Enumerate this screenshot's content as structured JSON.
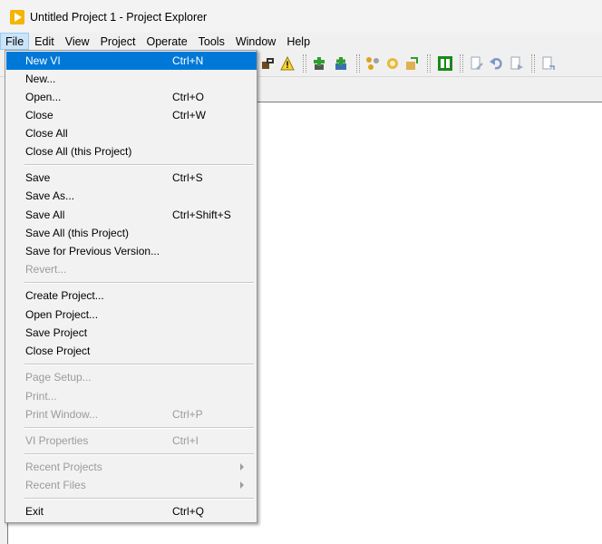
{
  "window": {
    "title": "Untitled Project 1 - Project Explorer"
  },
  "menubar": [
    "File",
    "Edit",
    "View",
    "Project",
    "Operate",
    "Tools",
    "Window",
    "Help"
  ],
  "file_menu": {
    "items": [
      {
        "label": "New VI",
        "shortcut": "Ctrl+N"
      },
      {
        "label": "New...",
        "shortcut": ""
      },
      {
        "label": "Open...",
        "shortcut": "Ctrl+O"
      },
      {
        "label": "Close",
        "shortcut": "Ctrl+W"
      },
      {
        "label": "Close All",
        "shortcut": ""
      },
      {
        "label": "Close All (this Project)",
        "shortcut": ""
      },
      {
        "label": "Save",
        "shortcut": "Ctrl+S"
      },
      {
        "label": "Save As...",
        "shortcut": ""
      },
      {
        "label": "Save All",
        "shortcut": "Ctrl+Shift+S"
      },
      {
        "label": "Save All (this Project)",
        "shortcut": ""
      },
      {
        "label": "Save for Previous Version...",
        "shortcut": ""
      },
      {
        "label": "Revert...",
        "shortcut": ""
      },
      {
        "label": "Create Project...",
        "shortcut": ""
      },
      {
        "label": "Open Project...",
        "shortcut": ""
      },
      {
        "label": "Save Project",
        "shortcut": ""
      },
      {
        "label": "Close Project",
        "shortcut": ""
      },
      {
        "label": "Page Setup...",
        "shortcut": ""
      },
      {
        "label": "Print...",
        "shortcut": ""
      },
      {
        "label": "Print Window...",
        "shortcut": "Ctrl+P"
      },
      {
        "label": "VI Properties",
        "shortcut": "Ctrl+I"
      },
      {
        "label": "Recent Projects",
        "shortcut": ""
      },
      {
        "label": "Recent Files",
        "shortcut": ""
      },
      {
        "label": "Exit",
        "shortcut": "Ctrl+Q"
      }
    ]
  },
  "colors": {
    "highlight": "#0078d7",
    "disabled_text": "#9b9b9b",
    "app_icon": "#f5b400"
  }
}
